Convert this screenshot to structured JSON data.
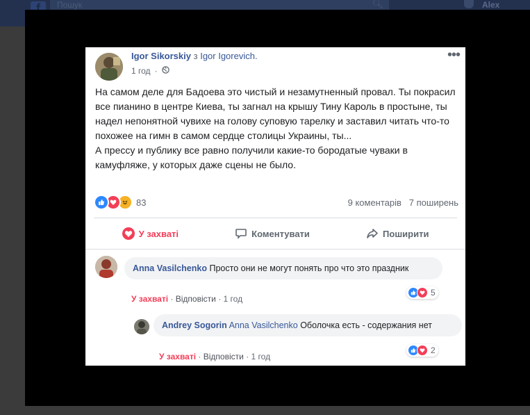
{
  "topbar": {
    "logo": "f",
    "search_placeholder": "Пошук",
    "user_name": "Alex"
  },
  "post": {
    "author": "Igor Sikorskiy",
    "connector": "з",
    "with_name": "Igor Igorevich.",
    "time": "1 год",
    "privacy_icon": "globe-icon",
    "more_label": "•••",
    "paragraph1": "На самом деле для Бадоева это чистый и незамутненный провал. Ты покрасил все пианино в центре Киева, ты загнал на крышу Тину Кароль в простыне, ты надел непонятной чувихе на голову суповую тарелку и заставил читать что-то похожее на гимн в самом сердце столицы Украины, ты...",
    "paragraph2": "А прессу и публику все равно получили какие-то бородатые чуваки в камуфляже, у которых даже сцены не было.",
    "reactions_count": "83",
    "comments_count": "9 коментарів",
    "shares_count": "7 поширень",
    "colors": {
      "like": "#2d88ff",
      "love": "#f33e58",
      "haha": "#f7b125",
      "link": "#385898"
    }
  },
  "actions": {
    "love_label": "У захваті",
    "comment_label": "Коментувати",
    "share_label": "Поширити"
  },
  "comments": [
    {
      "author": "Anna Vasilchenko",
      "text": "Просто они не могут понять про что это праздник",
      "love_label": "У захваті",
      "reply_label": "Відповісти",
      "time": "1 год",
      "separator": "·",
      "reactions": "5"
    },
    {
      "author": "Andrey Sogorin",
      "mention": "Anna Vasilchenko",
      "text": "Оболочка есть - содержания нет",
      "love_label": "У захваті",
      "reply_label": "Відповісти",
      "time": "1 год",
      "separator": "·",
      "reactions": "2"
    }
  ]
}
